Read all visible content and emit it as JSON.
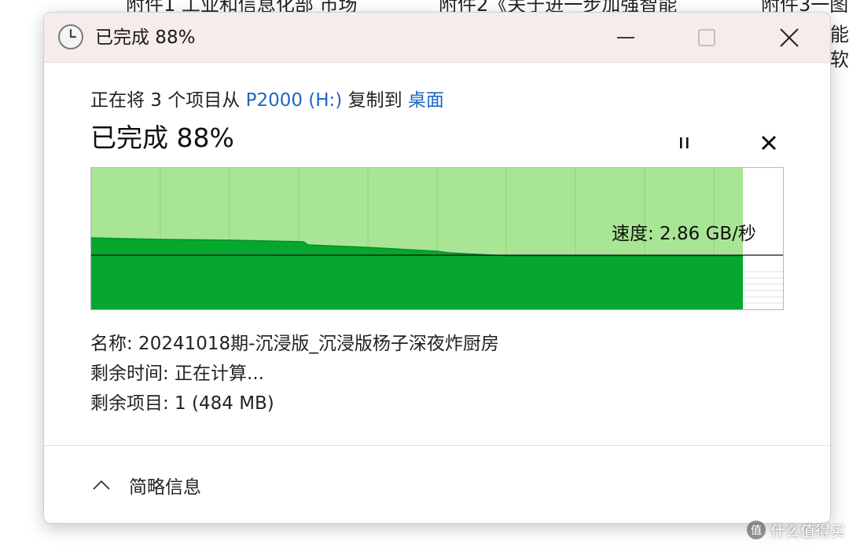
{
  "background": {
    "texts": [
      "附件1 工业和信息化部 市场",
      "附件2《关于进一步加强智能",
      "附件3一图",
      "能网",
      "软件"
    ]
  },
  "window": {
    "title": "已完成 88%",
    "copy_prefix": "正在将 3 个项目从 ",
    "source": "P2000 (H:)",
    "copy_middle": " 复制到 ",
    "destination": "桌面",
    "status": "已完成 88%",
    "progress_percent": 88,
    "speed_label": "速度: 2.86 GB/秒",
    "name_line": "名称: 20241018期-沉浸版_沉浸版杨子深夜炸厨房",
    "time_remaining_line": "剩余时间: 正在计算...",
    "items_remaining_line": "剩余项目: 1 (484 MB)",
    "details_toggle_label": "简略信息"
  },
  "colors": {
    "accent_link": "#1f66c2",
    "graph_light_green": "#a8e594",
    "graph_dark_green": "#06a72e",
    "titlebar_bg": "#f6ecec"
  },
  "watermark": {
    "text": "什么值得买",
    "badge": "值"
  }
}
